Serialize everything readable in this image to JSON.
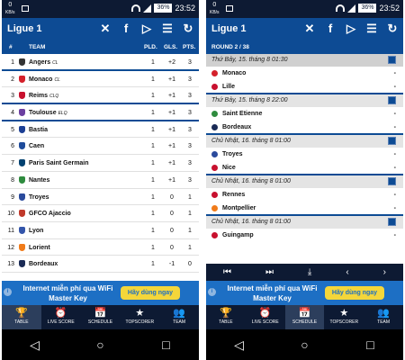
{
  "statusbar": {
    "speed": "0",
    "speed_unit": "KB/s",
    "battery": "36%",
    "time": "23:52"
  },
  "app": {
    "title": "Ligue 1"
  },
  "icons": [
    "close-icon",
    "facebook-icon",
    "play-store-icon",
    "settings-sliders-icon",
    "refresh-icon"
  ],
  "table": {
    "headers": {
      "pos": "#",
      "team": "TEAM",
      "pld": "PLD.",
      "gls": "GLS.",
      "pts": "PTS."
    },
    "rows": [
      {
        "pos": "1",
        "team": "Angers",
        "tag": "CL",
        "pld": "1",
        "gls": "+2",
        "pts": "3",
        "color": "#333333"
      },
      {
        "pos": "2",
        "team": "Monaco",
        "tag": "CL",
        "pld": "1",
        "gls": "+1",
        "pts": "3",
        "color": "#d4202a"
      },
      {
        "pos": "3",
        "team": "Reims",
        "tag": "CLQ",
        "pld": "1",
        "gls": "+1",
        "pts": "3",
        "color": "#c8102e"
      },
      {
        "pos": "4",
        "team": "Toulouse",
        "tag": "ELQ",
        "pld": "1",
        "gls": "+1",
        "pts": "3",
        "color": "#6b3fa0"
      },
      {
        "pos": "5",
        "team": "Bastia",
        "tag": "",
        "pld": "1",
        "gls": "+1",
        "pts": "3",
        "color": "#1c3f94"
      },
      {
        "pos": "6",
        "team": "Caen",
        "tag": "",
        "pld": "1",
        "gls": "+1",
        "pts": "3",
        "color": "#1e4b9b"
      },
      {
        "pos": "7",
        "team": "Paris Saint Germain",
        "tag": "",
        "pld": "1",
        "gls": "+1",
        "pts": "3",
        "color": "#004170"
      },
      {
        "pos": "8",
        "team": "Nantes",
        "tag": "",
        "pld": "1",
        "gls": "+1",
        "pts": "3",
        "color": "#2e8b3e"
      },
      {
        "pos": "9",
        "team": "Troyes",
        "tag": "",
        "pld": "1",
        "gls": "0",
        "pts": "1",
        "color": "#2a4a9c"
      },
      {
        "pos": "10",
        "team": "GFCO Ajaccio",
        "tag": "",
        "pld": "1",
        "gls": "0",
        "pts": "1",
        "color": "#c0392b"
      },
      {
        "pos": "11",
        "team": "Lyon",
        "tag": "",
        "pld": "1",
        "gls": "0",
        "pts": "1",
        "color": "#3355aa"
      },
      {
        "pos": "12",
        "team": "Lorient",
        "tag": "",
        "pld": "1",
        "gls": "0",
        "pts": "1",
        "color": "#f07b1a"
      },
      {
        "pos": "13",
        "team": "Bordeaux",
        "tag": "",
        "pld": "1",
        "gls": "-1",
        "pts": "0",
        "color": "#1a2a55"
      }
    ]
  },
  "fixtures": {
    "round": "ROUND 2 / 38",
    "groups": [
      {
        "date": "Thứ Bảy, 15. tháng 8 01:30",
        "home": "Monaco",
        "away": "Lille",
        "home_score": "-",
        "away_score": "-",
        "home_color": "#d4202a",
        "away_color": "#c8102e"
      },
      {
        "date": "Thứ Bảy, 15. tháng 8 22:00",
        "home": "Saint Etienne",
        "away": "Bordeaux",
        "home_score": "-",
        "away_score": "-",
        "home_color": "#2e8b3e",
        "away_color": "#1a2a55"
      },
      {
        "date": "Chủ Nhật, 16. tháng 8 01:00",
        "home": "Troyes",
        "away": "Nice",
        "home_score": "-",
        "away_score": "-",
        "home_color": "#2a4a9c",
        "away_color": "#c8102e"
      },
      {
        "date": "Chủ Nhật, 16. tháng 8 01:00",
        "home": "Rennes",
        "away": "Montpellier",
        "home_score": "-",
        "away_score": "-",
        "home_color": "#c8102e",
        "away_color": "#f07b1a"
      },
      {
        "date": "Chủ Nhật, 16. tháng 8 01:00",
        "home": "Guingamp",
        "away": "",
        "home_score": "-",
        "away_score": "",
        "home_color": "#c8102e",
        "away_color": "#ffffff"
      }
    ],
    "controls": [
      "⏮",
      "⏭",
      "⤓",
      "‹",
      "›"
    ]
  },
  "ad": {
    "text": "Internet miễn phí qua WiFi Master Key",
    "button": "Hãy dùng ngay",
    "info": "i"
  },
  "tabs": [
    {
      "label": "TABLE",
      "icon": "🏆"
    },
    {
      "label": "LIVE SCORE",
      "icon": "⏰"
    },
    {
      "label": "SCHEDULE",
      "icon": "📅"
    },
    {
      "label": "TOPSCORER",
      "icon": "★"
    },
    {
      "label": "TEAM",
      "icon": "👥"
    }
  ],
  "nav": [
    "◁",
    "○",
    "□"
  ]
}
